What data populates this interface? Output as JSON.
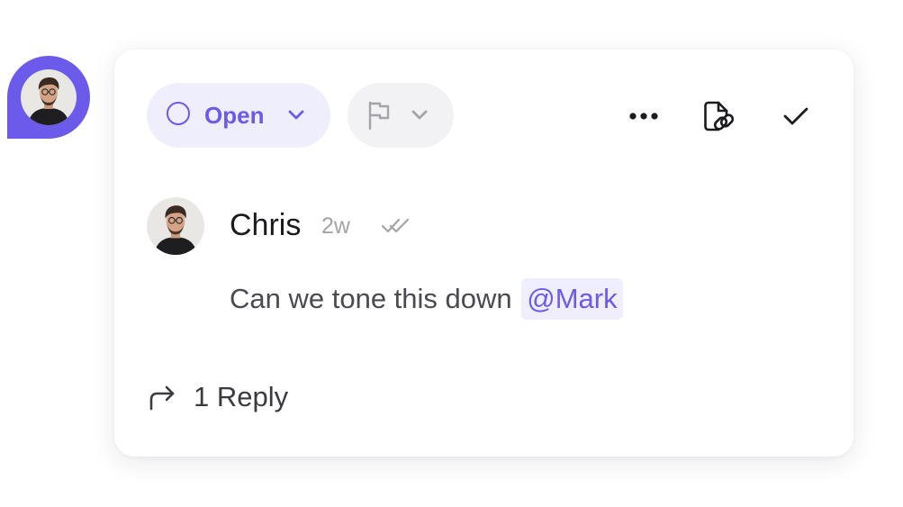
{
  "comment": {
    "status": "Open",
    "author": "Chris",
    "time_ago": "2w",
    "message_text": "Can we tone this down",
    "mention": "@Mark",
    "reply_count_label": "1 Reply"
  },
  "icons": {
    "status": "open-circle-icon",
    "status_dropdown": "chevron-down-icon",
    "flag": "flag-icon",
    "flag_dropdown": "chevron-down-icon",
    "more": "more-horizontal-icon",
    "copy_link": "copy-link-icon",
    "resolve": "check-icon",
    "read_receipt": "double-check-icon",
    "reply": "reply-arrow-icon"
  },
  "colors": {
    "accent": "#6c5bea",
    "accent_soft": "#efeefd",
    "neutral_pill": "#f2f2f4",
    "muted_text": "#a3a3aa",
    "body_text": "#4a4a50",
    "title_text": "#1b1b1f"
  }
}
